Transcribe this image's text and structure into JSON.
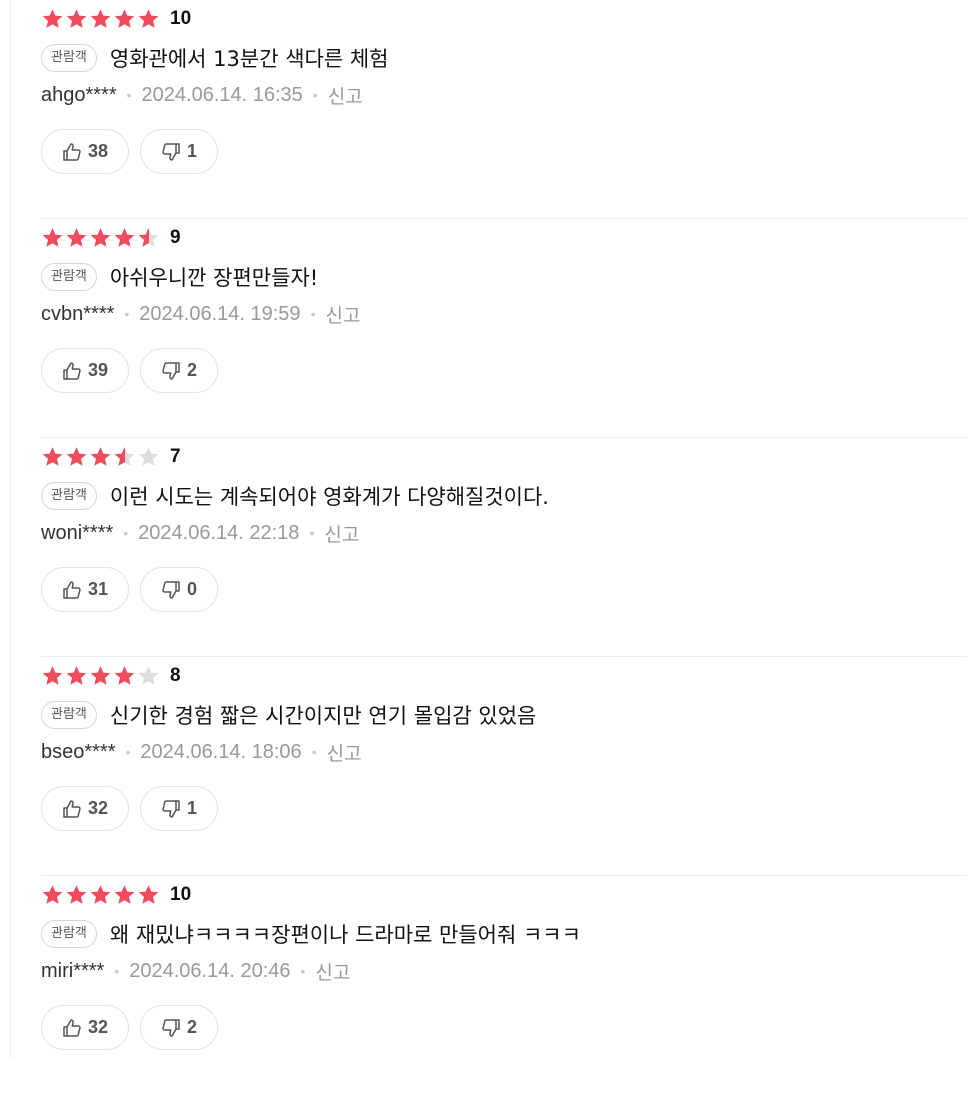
{
  "colors": {
    "star_filled": "#ee4b5d",
    "star_empty": "#dddddd"
  },
  "icons": {
    "star": "star-icon",
    "like": "thumbs-up-icon",
    "dislike": "thumbs-down-icon"
  },
  "reviews": [
    {
      "stars": 5,
      "score": "10",
      "badge": "관람객",
      "comment": "영화관에서 13분간 색다른 체험",
      "user": "ahgo****",
      "date": "2024.06.14. 16:35",
      "report": "신고",
      "likes": "38",
      "dislikes": "1"
    },
    {
      "stars": 4.5,
      "score": "9",
      "badge": "관람객",
      "comment": "아쉬우니깐 장편만들자!",
      "user": "cvbn****",
      "date": "2024.06.14. 19:59",
      "report": "신고",
      "likes": "39",
      "dislikes": "2"
    },
    {
      "stars": 3.5,
      "score": "7",
      "badge": "관람객",
      "comment": "이런 시도는 계속되어야 영화계가 다양해질것이다.",
      "user": "woni****",
      "date": "2024.06.14. 22:18",
      "report": "신고",
      "likes": "31",
      "dislikes": "0"
    },
    {
      "stars": 4,
      "score": "8",
      "badge": "관람객",
      "comment": "신기한 경험 짧은 시간이지만 연기 몰입감 있었음",
      "user": "bseo****",
      "date": "2024.06.14. 18:06",
      "report": "신고",
      "likes": "32",
      "dislikes": "1"
    },
    {
      "stars": 5,
      "score": "10",
      "badge": "관람객",
      "comment": "왜 재밌냐ㅋㅋㅋㅋ장편이나 드라마로 만들어줘 ㅋㅋㅋ",
      "user": "miri****",
      "date": "2024.06.14. 20:46",
      "report": "신고",
      "likes": "32",
      "dislikes": "2"
    }
  ]
}
